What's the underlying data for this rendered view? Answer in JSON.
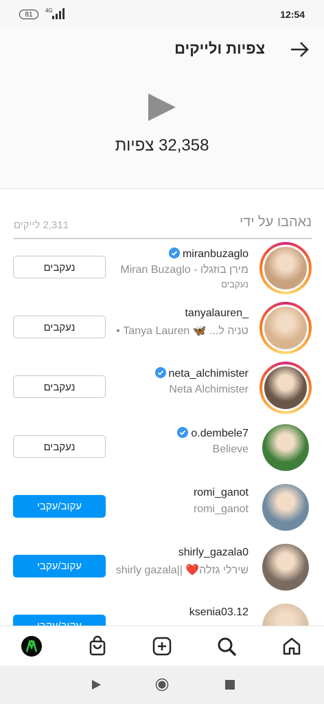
{
  "status_bar": {
    "battery": "81",
    "network": "4G",
    "time": "12:54"
  },
  "header": {
    "title": "צפיות ולייקים"
  },
  "views": {
    "count_text": "32,358 צפיות"
  },
  "liked_by": {
    "title": "נאהבו על ידי",
    "likes_count": "2,311 לייקים"
  },
  "users": [
    {
      "username": "miranbuzaglo",
      "verified": true,
      "full_name": "מירן בוזגלו - Miran Buzaglo",
      "sub_text": "נעקבים",
      "button": "נעקבים",
      "button_style": "following",
      "story_ring": true,
      "avatar_color": "#c9a27e"
    },
    {
      "username": "tanyalauren_",
      "verified": false,
      "full_name": "טניה ל... 🦋 Tanya Lauren •",
      "sub_text": "",
      "button": "נעקבים",
      "button_style": "following",
      "story_ring": true,
      "avatar_color": "#d8b48f"
    },
    {
      "username": "neta_alchimister",
      "verified": true,
      "full_name": "Neta Alchimister",
      "sub_text": "",
      "button": "נעקבים",
      "button_style": "following",
      "story_ring": true,
      "avatar_color": "#6a5648"
    },
    {
      "username": "o.dembele7",
      "verified": true,
      "full_name": "Believe",
      "sub_text": "",
      "button": "נעקבים",
      "button_style": "following",
      "story_ring": false,
      "avatar_color": "#3f7f3a"
    },
    {
      "username": "romi_ganot",
      "verified": false,
      "full_name": "romi_ganot",
      "sub_text": "",
      "button": "עקוב/עקבי",
      "button_style": "follow",
      "story_ring": false,
      "avatar_color": "#6f8aa0"
    },
    {
      "username": "shirly_gazala0",
      "verified": false,
      "full_name": "שירלי גזלה❤️ ||shirly gazala",
      "sub_text": "",
      "button": "עקוב/עקבי",
      "button_style": "follow",
      "story_ring": false,
      "avatar_color": "#7a6b60"
    },
    {
      "username": "ksenia03.12",
      "verified": false,
      "full_name": "",
      "sub_text": "",
      "button": "עקוב/עקבי",
      "button_style": "follow",
      "story_ring": false,
      "avatar_color": "#d9c2a6"
    }
  ],
  "bottom_nav": [
    "profile-icon",
    "shop-icon",
    "new-post-icon",
    "search-icon",
    "home-icon"
  ],
  "colors": {
    "accent": "#0095f6",
    "verified": "#3897f0"
  }
}
